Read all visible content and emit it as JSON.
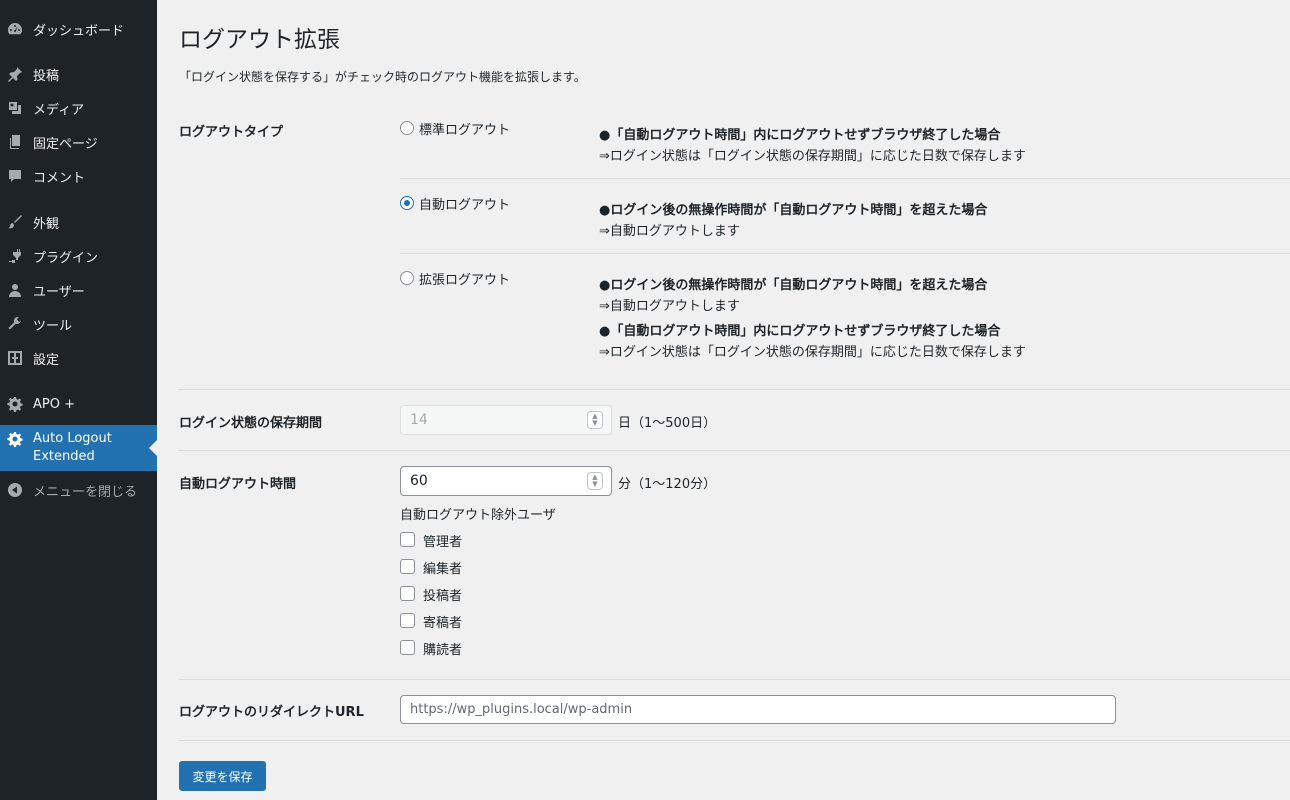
{
  "sidebar": {
    "items": [
      {
        "label": "ダッシュボード",
        "icon": "dashboard-icon"
      },
      {
        "label": "投稿",
        "icon": "pin-icon"
      },
      {
        "label": "メディア",
        "icon": "media-icon"
      },
      {
        "label": "固定ページ",
        "icon": "page-icon"
      },
      {
        "label": "コメント",
        "icon": "comment-icon"
      },
      {
        "label": "外観",
        "icon": "brush-icon"
      },
      {
        "label": "プラグイン",
        "icon": "plugin-icon"
      },
      {
        "label": "ユーザー",
        "icon": "user-icon"
      },
      {
        "label": "ツール",
        "icon": "wrench-icon"
      },
      {
        "label": "設定",
        "icon": "settings-icon"
      },
      {
        "label": "APO +",
        "icon": "gear-icon"
      },
      {
        "label": "Auto Logout Extended",
        "icon": "gear-icon",
        "active": true
      },
      {
        "label": "メニューを閉じる",
        "icon": "collapse-icon"
      }
    ]
  },
  "page": {
    "title": "ログアウト拡張",
    "description": "「ログイン状態を保存する」がチェック時のログアウト機能を拡張します。"
  },
  "logout_type": {
    "label": "ログアウトタイプ",
    "options": [
      {
        "label": "標準ログアウト",
        "checked": false,
        "notes": [
          {
            "heading": "●「自動ログアウト時間」内にログアウトせずブラウザ終了した場合",
            "text": "⇒ログイン状態は「ログイン状態の保存期間」に応じた日数で保存します"
          }
        ]
      },
      {
        "label": "自動ログアウト",
        "checked": true,
        "notes": [
          {
            "heading": "●ログイン後の無操作時間が「自動ログアウト時間」を超えた場合",
            "text": "⇒自動ログアウトします"
          }
        ]
      },
      {
        "label": "拡張ログアウト",
        "checked": false,
        "notes": [
          {
            "heading": "●ログイン後の無操作時間が「自動ログアウト時間」を超えた場合",
            "text": "⇒自動ログアウトします"
          },
          {
            "heading": "●「自動ログアウト時間」内にログアウトせずブラウザ終了した場合",
            "text": "⇒ログイン状態は「ログイン状態の保存期間」に応じた日数で保存します"
          }
        ]
      }
    ]
  },
  "save_period": {
    "label": "ログイン状態の保存期間",
    "value": "14",
    "unit": "日（1〜500日）",
    "disabled": true
  },
  "auto_logout": {
    "label": "自動ログアウト時間",
    "value": "60",
    "unit": "分（1〜120分）",
    "exclude_label": "自動ログアウト除外ユーザ",
    "roles": [
      {
        "label": "管理者",
        "checked": false
      },
      {
        "label": "編集者",
        "checked": false
      },
      {
        "label": "投稿者",
        "checked": false
      },
      {
        "label": "寄稿者",
        "checked": false
      },
      {
        "label": "購読者",
        "checked": false
      }
    ]
  },
  "redirect": {
    "label": "ログアウトのリダイレクトURL",
    "placeholder": "https://wp_plugins.local/wp-admin"
  },
  "save_button": "変更を保存",
  "colors": {
    "sidebar_bg": "#1d2327",
    "accent": "#2271b1",
    "page_bg": "#f0f0f1"
  }
}
